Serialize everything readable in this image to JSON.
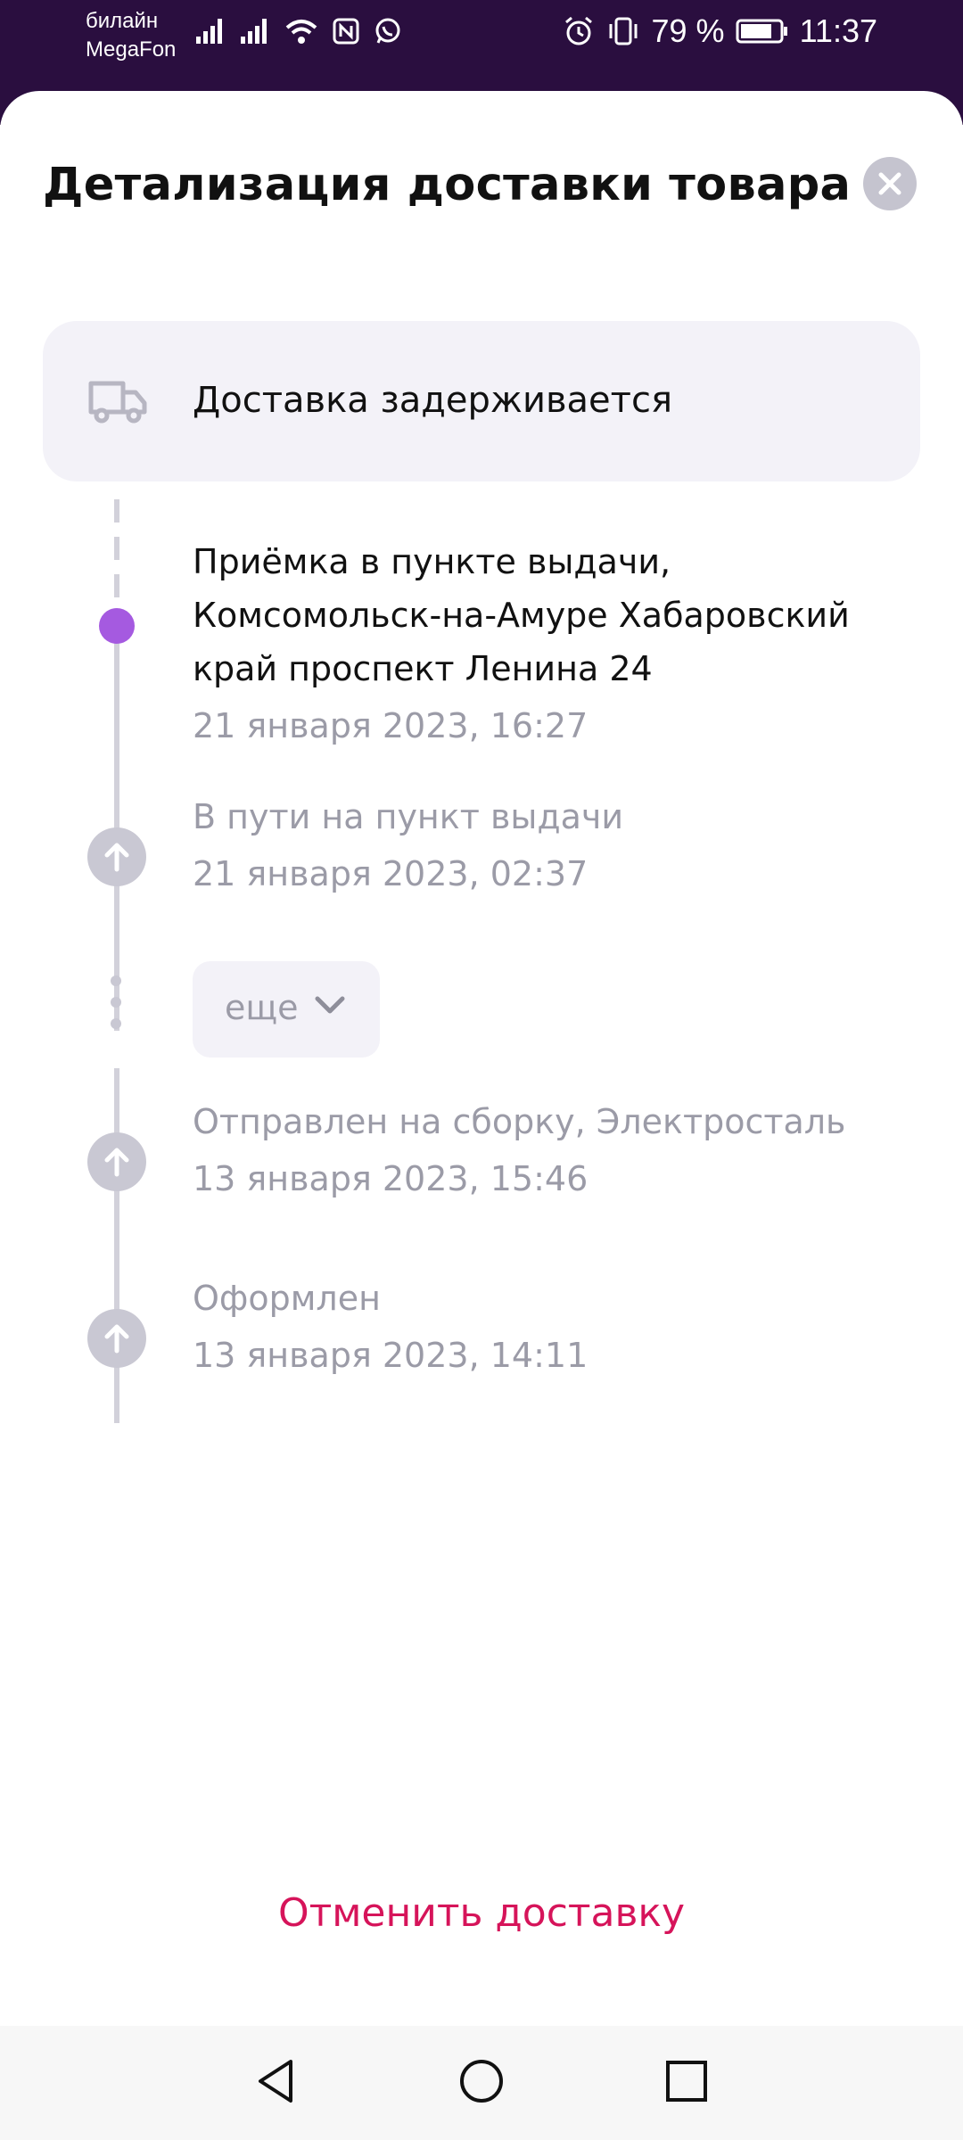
{
  "status_bar": {
    "carrier_1": "билайн",
    "carrier_2": "MegaFon",
    "battery": "79 %",
    "time": "11:37"
  },
  "sheet": {
    "title": "Детализация доставки товара",
    "close_icon": "close-icon",
    "status": {
      "icon": "truck-icon",
      "text": "Доставка задерживается"
    },
    "events": [
      {
        "title_lines": [
          "Приёмка в пункте выдачи,",
          "Комсомольск-на-Амуре Хабаровский",
          "край проспект Ленина 24"
        ],
        "date": "21 января 2023, 16:27",
        "active": true
      },
      {
        "title": "В пути на пункт выдачи",
        "date": "21 января 2023, 02:37"
      },
      {
        "title": "Отправлен на сборку, Электросталь",
        "date": "13 января 2023, 15:46"
      },
      {
        "title": "Оформлен",
        "date": "13 января 2023, 14:11"
      }
    ],
    "more_label": "еще",
    "cancel_label": "Отменить доставку"
  },
  "colors": {
    "accent_purple": "#a55ae0",
    "cancel_red": "#d6145a",
    "status_bar_bg": "#2a0e3f"
  }
}
